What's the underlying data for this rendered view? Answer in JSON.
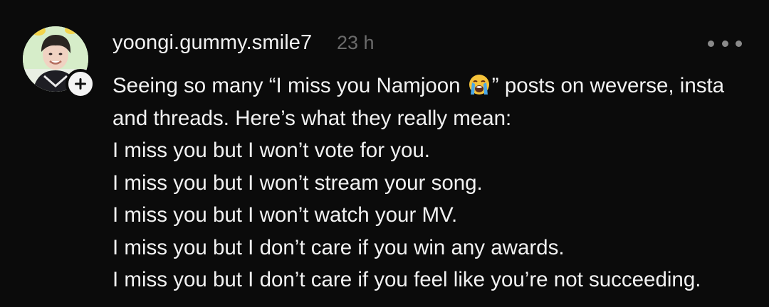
{
  "post": {
    "username": "yoongi.gummy.smile7",
    "timestamp": "23 h",
    "more_icon": "more-horizontal-icon",
    "follow_icon": "plus-icon",
    "avatar_alt": "profile picture",
    "text": {
      "line1_before": "Seeing so many “I miss you Namjoon ",
      "emoji": "loudly-crying-face-emoji",
      "line1_after": "” posts on weverse, insta",
      "line2": "and threads. Here’s what they really mean:",
      "line3": "I miss you but I won’t vote for you.",
      "line4": "I miss you but I won’t stream your song.",
      "line5": "I miss you but I won’t watch your MV.",
      "line6": "I miss you but I don’t care if you win any awards.",
      "line7": "I miss you but I don’t care if you feel like you’re not succeeding."
    }
  },
  "colors": {
    "background": "#0b0b0b",
    "text": "#f2f2f2",
    "muted": "#6b6b6b",
    "avatar_bg": "#cfe9c8"
  }
}
